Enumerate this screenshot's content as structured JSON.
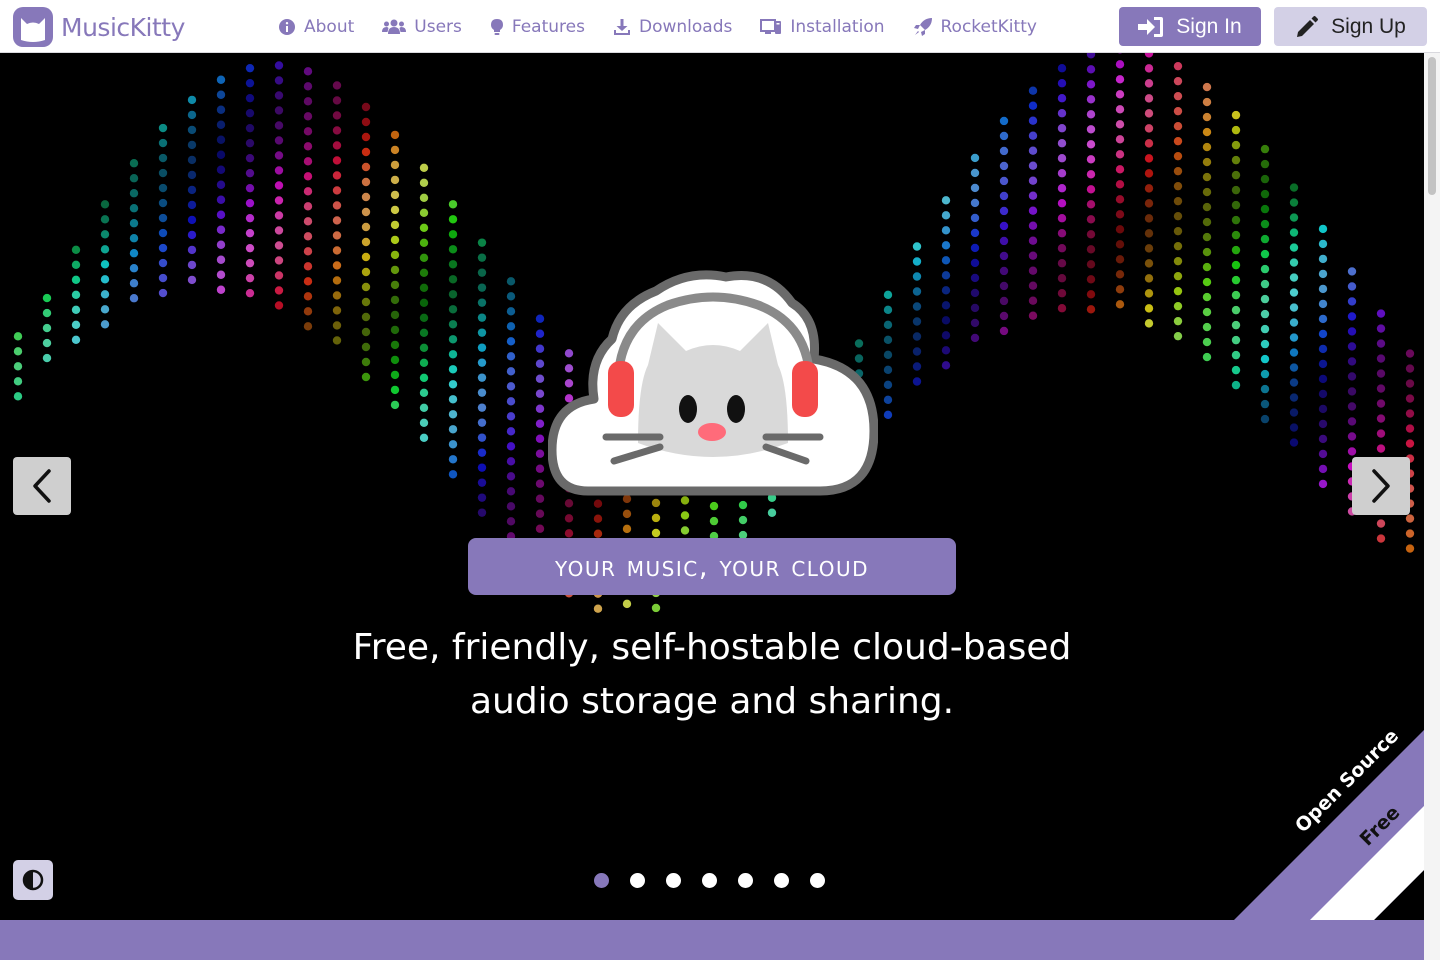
{
  "brand": {
    "name": "MusicKitty",
    "accent": "#8778ba"
  },
  "nav": {
    "items": [
      {
        "label": "About",
        "icon": "info-circle-icon"
      },
      {
        "label": "Users",
        "icon": "users-icon"
      },
      {
        "label": "Features",
        "icon": "lightbulb-icon"
      },
      {
        "label": "Downloads",
        "icon": "download-icon"
      },
      {
        "label": "Installation",
        "icon": "install-icon"
      },
      {
        "label": "RocketKitty",
        "icon": "rocket-icon"
      }
    ],
    "sign_in": "Sign In",
    "sign_up": "Sign Up"
  },
  "hero": {
    "tagline": "Your Music, Your Cloud",
    "subtitle_line1": "Free, friendly, self-hostable cloud-based",
    "subtitle_line2": "audio storage and sharing.",
    "slides_total": 7,
    "active_slide": 1
  },
  "ribbon": {
    "line1": "Open Source",
    "line2": "Free"
  }
}
